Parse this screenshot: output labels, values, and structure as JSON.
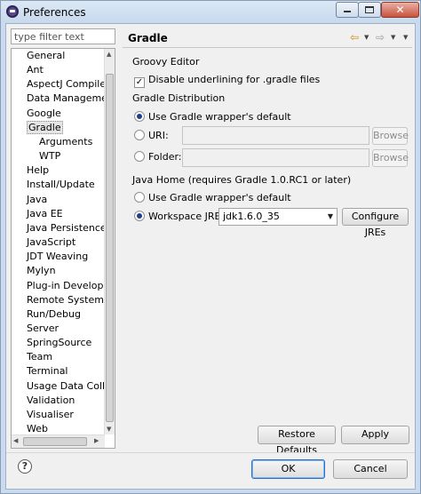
{
  "window": {
    "title": "Preferences",
    "minimize_label": "",
    "maximize_label": "",
    "close_label": "✕"
  },
  "filter": {
    "placeholder": "type filter text",
    "value": ""
  },
  "tree": {
    "items": [
      {
        "label": "General",
        "level": 0
      },
      {
        "label": "Ant",
        "level": 0
      },
      {
        "label": "AspectJ Compiler",
        "level": 0
      },
      {
        "label": "Data Management",
        "level": 0
      },
      {
        "label": "Google",
        "level": 0
      },
      {
        "label": "Gradle",
        "level": 0,
        "selected": true
      },
      {
        "label": "Arguments",
        "level": 1
      },
      {
        "label": "WTP",
        "level": 1
      },
      {
        "label": "Help",
        "level": 0
      },
      {
        "label": "Install/Update",
        "level": 0
      },
      {
        "label": "Java",
        "level": 0
      },
      {
        "label": "Java EE",
        "level": 0
      },
      {
        "label": "Java Persistence",
        "level": 0
      },
      {
        "label": "JavaScript",
        "level": 0
      },
      {
        "label": "JDT Weaving",
        "level": 0
      },
      {
        "label": "Mylyn",
        "level": 0
      },
      {
        "label": "Plug-in Development",
        "level": 0
      },
      {
        "label": "Remote Systems",
        "level": 0
      },
      {
        "label": "Run/Debug",
        "level": 0
      },
      {
        "label": "Server",
        "level": 0
      },
      {
        "label": "SpringSource",
        "level": 0
      },
      {
        "label": "Team",
        "level": 0
      },
      {
        "label": "Terminal",
        "level": 0
      },
      {
        "label": "Usage Data Collector",
        "level": 0
      },
      {
        "label": "Validation",
        "level": 0
      },
      {
        "label": "Visualiser",
        "level": 0
      },
      {
        "label": "Web",
        "level": 0
      }
    ]
  },
  "page": {
    "title": "Gradle",
    "groovy": {
      "heading": "Groovy Editor",
      "disable_underlining_label": "Disable underlining for .gradle files",
      "disable_underlining_checked": true
    },
    "distribution": {
      "heading": "Gradle Distribution",
      "wrapper_label": "Use Gradle wrapper's default",
      "uri_label": "URI:",
      "folder_label": "Folder:",
      "uri_value": "",
      "folder_value": "",
      "browse_label": "Browse",
      "selected": "wrapper"
    },
    "java_home": {
      "heading": "Java Home (requires Gradle 1.0.RC1 or later)",
      "wrapper_label": "Use Gradle wrapper's default",
      "workspace_label": "Workspace JRE:",
      "jre_value": "jdk1.6.0_35",
      "configure_label": "Configure JREs",
      "selected": "workspace"
    },
    "restore_defaults_label": "Restore Defaults",
    "apply_label": "Apply"
  },
  "footer": {
    "help_symbol": "?",
    "ok_label": "OK",
    "cancel_label": "Cancel"
  }
}
